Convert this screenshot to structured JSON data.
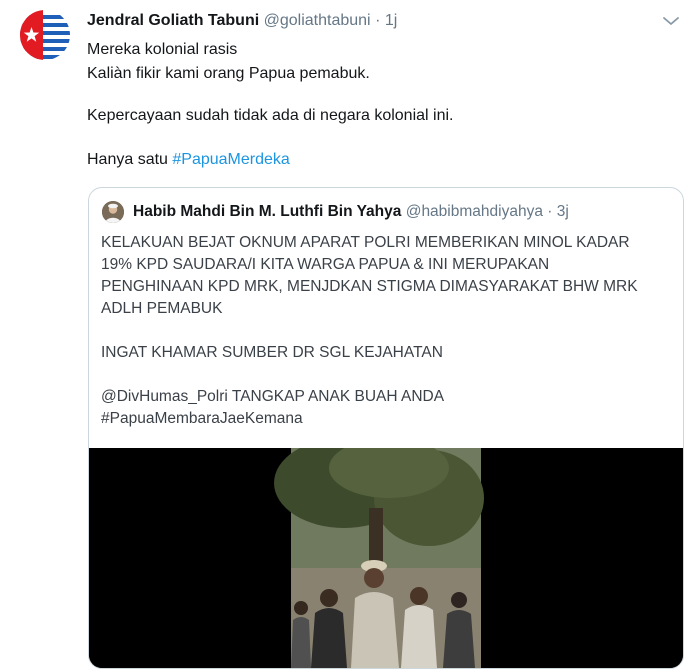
{
  "tweet": {
    "author_name": "Jendral Goliath Tabuni",
    "author_handle": "@goliathtabuni",
    "separator": "·",
    "time": "1j",
    "lines": [
      "Mereka kolonial rasis",
      "Kaliàn fikir kami orang Papua pemabuk.",
      "Kepercayaan sudah tidak ada di negara kolonial ini."
    ],
    "last_line_prefix": "Hanya satu ",
    "hashtag": "#PapuaMerdeka"
  },
  "quoted": {
    "author_name": "Habib Mahdi Bin M. Luthfi Bin Yahya",
    "author_handle": "@habibmahdiyahya",
    "separator": "·",
    "time": "3j",
    "lines": [
      "KELAKUAN BEJAT OKNUM APARAT POLRI MEMBERIKAN MINOL KADAR",
      "19% KPD SAUDARA/I KITA WARGA PAPUA & INI MERUPAKAN",
      "PENGHINAAN KPD MRK, MENJDKAN STIGMA DIMASYARAKAT BHW MRK",
      "ADLH PEMABUK",
      "INGAT KHAMAR SUMBER DR SGL KEJAHATAN",
      "@DivHumas_Polri TANGKAP ANAK BUAH ANDA",
      "#PapuaMembaraJaeKemana"
    ]
  },
  "colors": {
    "link": "#1b95e0",
    "muted": "#657786",
    "border": "#ccd6dd"
  },
  "icons": {
    "avatar": "morning-star-flag",
    "menu": "chevron-down-icon"
  }
}
